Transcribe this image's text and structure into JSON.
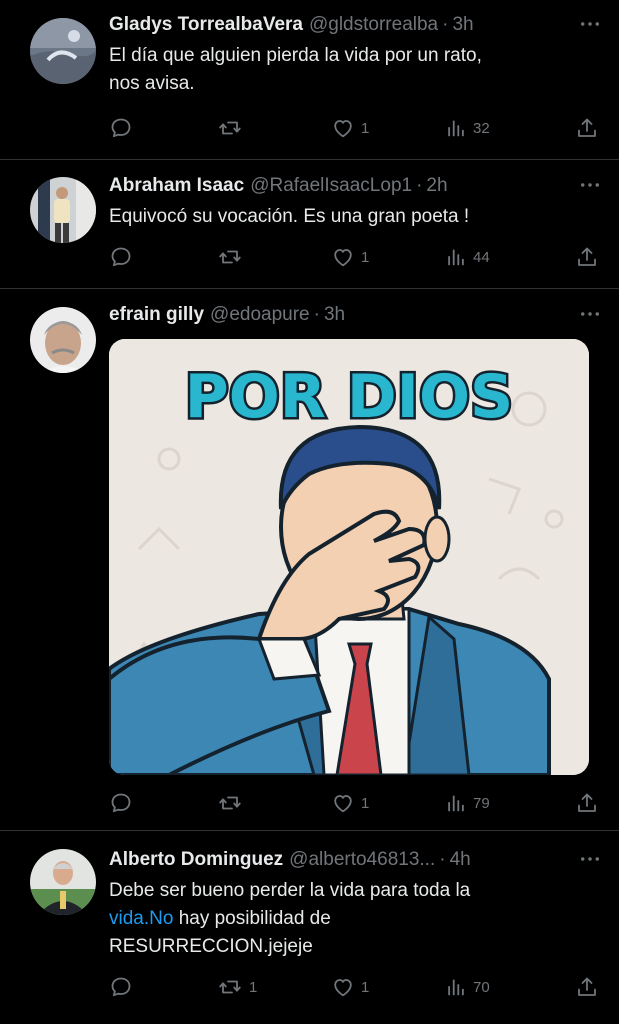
{
  "tweets": [
    {
      "name": "Gladys TorrealbaVera",
      "handle": "@gldstorrealba",
      "time": "3h",
      "text_lines": [
        "El día que alguien pierda la vida por un rato,",
        "nos avisa."
      ],
      "replies": "",
      "retweets": "",
      "likes": "1",
      "views": "32"
    },
    {
      "name": "Abraham Isaac",
      "handle": "@RafaelIsaacLop1",
      "time": "2h",
      "text_lines": [
        "Equivocó su vocación. Es una gran poeta !"
      ],
      "replies": "",
      "retweets": "",
      "likes": "1",
      "views": "44"
    },
    {
      "name": "efrain gilly",
      "handle": "@edoapure",
      "time": "3h",
      "media_text": "POR DIOS",
      "replies": "",
      "retweets": "",
      "likes": "1",
      "views": "79"
    },
    {
      "name": "Alberto Dominguez",
      "handle": "@alberto46813...",
      "time": "4h",
      "text_line1": "Debe ser bueno perder la vida para toda la",
      "text_link": "vida.No",
      "text_line2_rest": " hay posibilidad de",
      "text_line3": "RESURRECCION.jejeje",
      "replies": "",
      "retweets": "1",
      "likes": "1",
      "views": "70"
    }
  ],
  "icons": {
    "reply": "reply-icon",
    "retweet": "retweet-icon",
    "like": "heart-icon",
    "views": "views-icon",
    "share": "share-icon",
    "more": "more-icon"
  },
  "colors": {
    "background": "#000000",
    "text": "#e7e9ea",
    "secondary": "#71767b",
    "link": "#1d9bf0",
    "divider": "#2f3336"
  }
}
